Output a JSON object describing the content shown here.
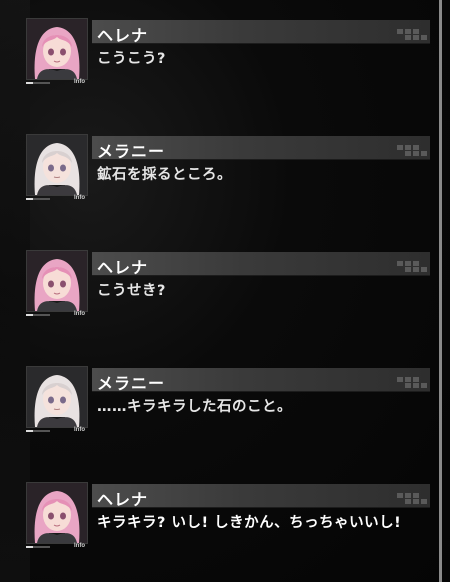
{
  "log": {
    "entries": [
      {
        "speaker": "ヘレナ",
        "line": "こうこう?",
        "character": "helena",
        "info_label": "Info"
      },
      {
        "speaker": "メラニー",
        "line": "鉱石を採るところ。",
        "character": "melanie",
        "info_label": "Info"
      },
      {
        "speaker": "ヘレナ",
        "line": "こうせき?",
        "character": "helena",
        "info_label": "Info"
      },
      {
        "speaker": "メラニー",
        "line": "……キラキラした石のこと。",
        "character": "melanie",
        "info_label": "Info"
      },
      {
        "speaker": "ヘレナ",
        "line": "キラキラ? いし! しきかん、ちっちゃいいし!",
        "character": "helena",
        "info_label": "Info"
      }
    ]
  },
  "colors": {
    "helena_hair": "#e9a5c4",
    "melanie_hair": "#e8e2e2",
    "name_bar": "#444444",
    "text": "#e6e6e6"
  }
}
